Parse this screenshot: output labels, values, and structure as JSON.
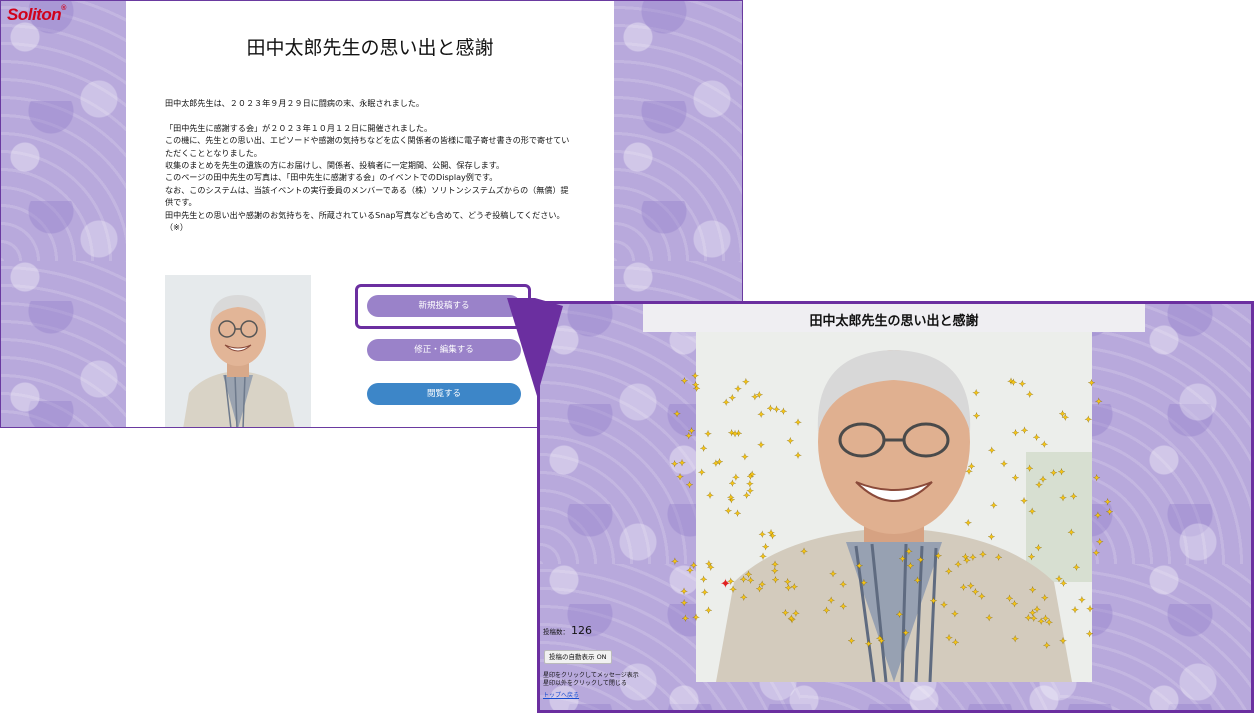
{
  "brand": {
    "logo_text": "Soliton",
    "logo_mark": "®",
    "logo_color": "#d0021b"
  },
  "left_page": {
    "title": "田中太郎先生の思い出と感謝",
    "intro_lines": [
      "田中太郎先生は、２０２３年９月２９日に闘病の末、永眠されました。",
      "",
      "「田中先生に感謝する会」が２０２３年１０月１２日に開催されました。",
      "この機に、先生との思い出、エピソードや感謝の気持ちなどを広く関係者の皆様に電子寄せ書きの形で寄せてい",
      "ただくこととなりました。",
      "収集のまとめを先生の遺族の方にお届けし、関係者、投稿者に一定期間、公開、保存します。",
      "このページの田中先生の写真は、「田中先生に感謝する会」のイベントでのDisplay例です。",
      "なお、このシステムは、当該イベントの実行委員のメンバーである（株）ソリトンシステムズからの（無償）提",
      "供です。",
      "田中先生との思い出や感謝のお気持ちを、所蔵されているSnap写真なども含めて、どうぞ投稿してください。",
      "（※）"
    ],
    "buttons": {
      "new_post": "新規投稿する",
      "edit": "修正・編集する",
      "view": "閲覧する"
    },
    "colors": {
      "menu_purple": "#9a82c9",
      "view_blue": "#3d86c8",
      "highlight": "#6b2fa0"
    }
  },
  "right_page": {
    "title": "田中太郎先生の思い出と感謝",
    "post_count_label": "投稿数：",
    "post_count_value": "126",
    "auto_display_button": "投稿の自動表示 ON",
    "help_line1": "星印をクリックしてメッセージ表示",
    "help_line2": "星印以外をクリックして閉じる",
    "back_link": "トップへ戻る",
    "star_color": "#f5c518",
    "highlight_star_color": "#e02020"
  }
}
